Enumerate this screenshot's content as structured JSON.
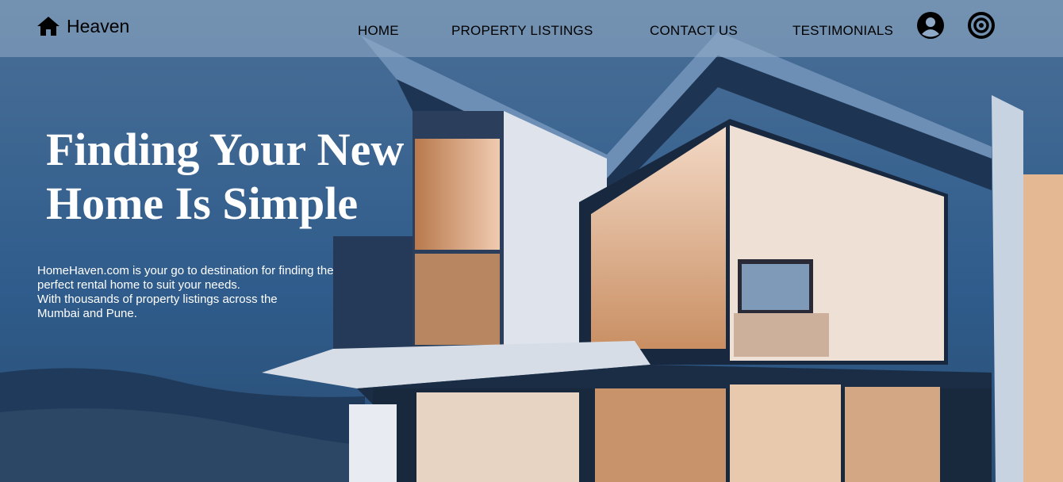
{
  "nav": {
    "logo_text": "Heaven",
    "links": [
      "HOME",
      "PROPERTY LISTINGS",
      "CONTACT US",
      "TESTIMONIALS"
    ]
  },
  "hero": {
    "headline_line1": "Finding Your New",
    "headline_line2": "Home Is Simple",
    "description_lines": [
      "HomeHaven.com is your go to destination for finding the",
      "perfect rental home to suit your needs.",
      "With thousands of property listings across the",
      "Mumbai and Pune."
    ]
  },
  "icons": {
    "home": "home-icon",
    "user": "user-circle-icon",
    "target": "target-icon"
  },
  "colors": {
    "navbar": "#96afc8",
    "text_dark": "#000000",
    "text_light": "#ffffff"
  }
}
